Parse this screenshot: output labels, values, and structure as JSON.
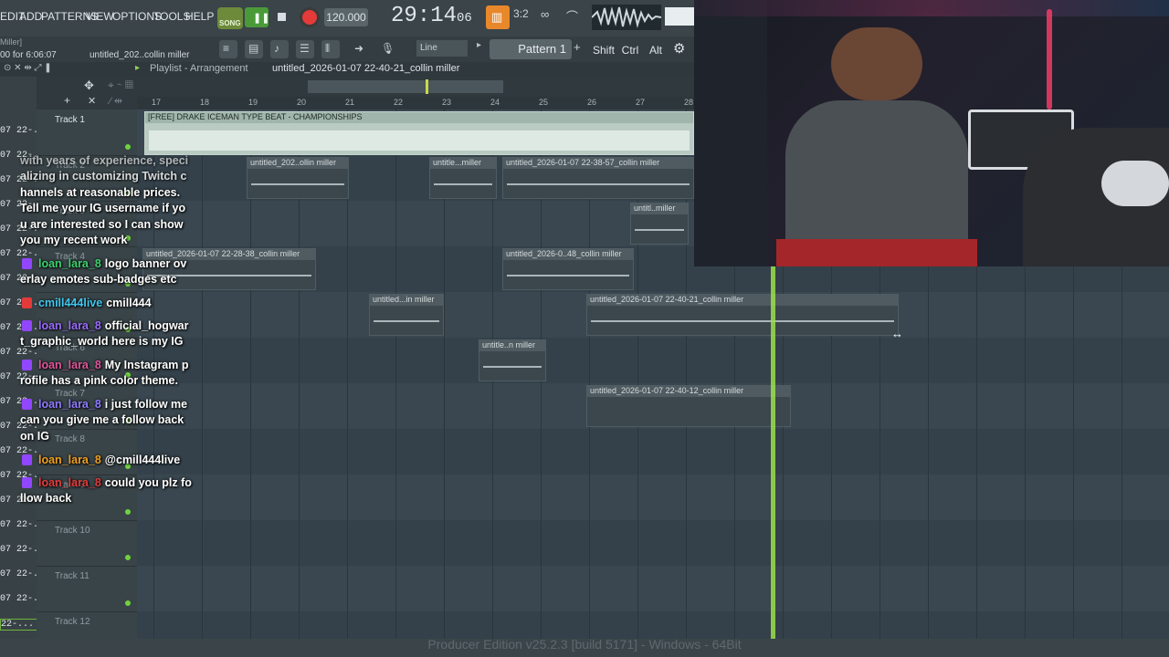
{
  "menu": {
    "items": [
      "EDIT",
      "ADD",
      "PATTERNS",
      "VIEW",
      "OPTIONS",
      "TOOLS",
      "HELP"
    ],
    "song_label": "SONG",
    "tempo": "120.000",
    "time": "29:14",
    "time_small": "06",
    "pattern": "Pattern 1",
    "snap": "Line",
    "keys": [
      "Shift",
      "Ctrl",
      "Alt"
    ]
  },
  "status": {
    "hint_top": "Miller]",
    "hint_bottom": "00 for 6:06:07",
    "clip_hint": "untitled_202..collin miller"
  },
  "playlist": {
    "title": "Playlist - Arrangement",
    "file": "untitled_2026-01-07 22-40-21_collin miller",
    "ruler": [
      "17",
      "18",
      "19",
      "20",
      "21",
      "22",
      "23",
      "24",
      "25",
      "26",
      "27",
      "28"
    ]
  },
  "tracks": [
    "Track 1",
    "Track 2",
    "Track 3",
    "Track 4",
    "Track 5",
    "Track 6",
    "Track 7",
    "Track 8",
    "Track 9",
    "Track 10",
    "Track 11",
    "Track 12"
  ],
  "left_strip": [
    "07 22-...",
    "07 22-...",
    "07 22-...",
    "07 22-...",
    "07 22-...",
    "07 22-...",
    "07 22-...",
    "07 22-...",
    "07 22-...",
    "07 22-...",
    "07 22-...",
    "07 22-...",
    "07 22-...",
    "07 22-...",
    "07 22-...",
    "07 22-...",
    "07 22-...",
    "07 22-...",
    "07 22-...",
    "07 22-...",
    "22-..."
  ],
  "clips": {
    "c1": "[FREE] DRAKE ICEMAN TYPE BEAT - CHAMPIONSHIPS",
    "c2": "untitled_202..ollin miller",
    "c3": "untitle...miller",
    "c4": "untitled_2026-01-07 22-38-57_collin miller",
    "c5": "untitl..miller",
    "c6": "untitled_2026-01-07 22-28-38_collin miller",
    "c7": "untitled_2026-0..48_collin miller",
    "c8": "untitled...in miller",
    "c9": "untitled_2026-01-07 22-40-21_collin miller",
    "c10": "untitle..n miller",
    "c11": "untitled_2026-01-07 22-40-12_collin miller"
  },
  "chat": {
    "intro_lines": [
      "with years of experience, speci",
      "alizing in customizing Twitch c",
      "hannels at reasonable prices.",
      "Tell me your IG username if yo",
      "u are interested so I can show",
      "you my recent work"
    ],
    "messages": [
      {
        "user": "loan_lara_8",
        "text": "logo banner ov",
        "cont": "erlay emotes sub-badges etc",
        "color": "#3bd16f"
      },
      {
        "user": "cmill444live",
        "text": "cmill444",
        "cont": "",
        "color": "#41c7f0"
      },
      {
        "user": "loan_lara_8",
        "text": "official_hogwar",
        "cont": "t_graphic_world here is my IG",
        "color": "#9b6bff"
      },
      {
        "user": "loan_lara_8",
        "text": "My Instagram p",
        "cont": "rofile has a pink color theme.",
        "color": "#e0569c"
      },
      {
        "user": "loan_lara_8",
        "text": "i just follow me",
        "cont": "can you give me a follow back",
        "cont2": "on IG",
        "color": "#8f7bff"
      },
      {
        "user": "loan_lara_8",
        "text": "@cmill444live",
        "cont": "",
        "color": "#f0a020"
      },
      {
        "user": "loan_lara_8",
        "text": "could you plz fo",
        "cont": "llow back",
        "color": "#e23b3b"
      }
    ]
  },
  "footer": "Producer Edition v25.2.3 [build 5171] - Windows - 64Bit"
}
